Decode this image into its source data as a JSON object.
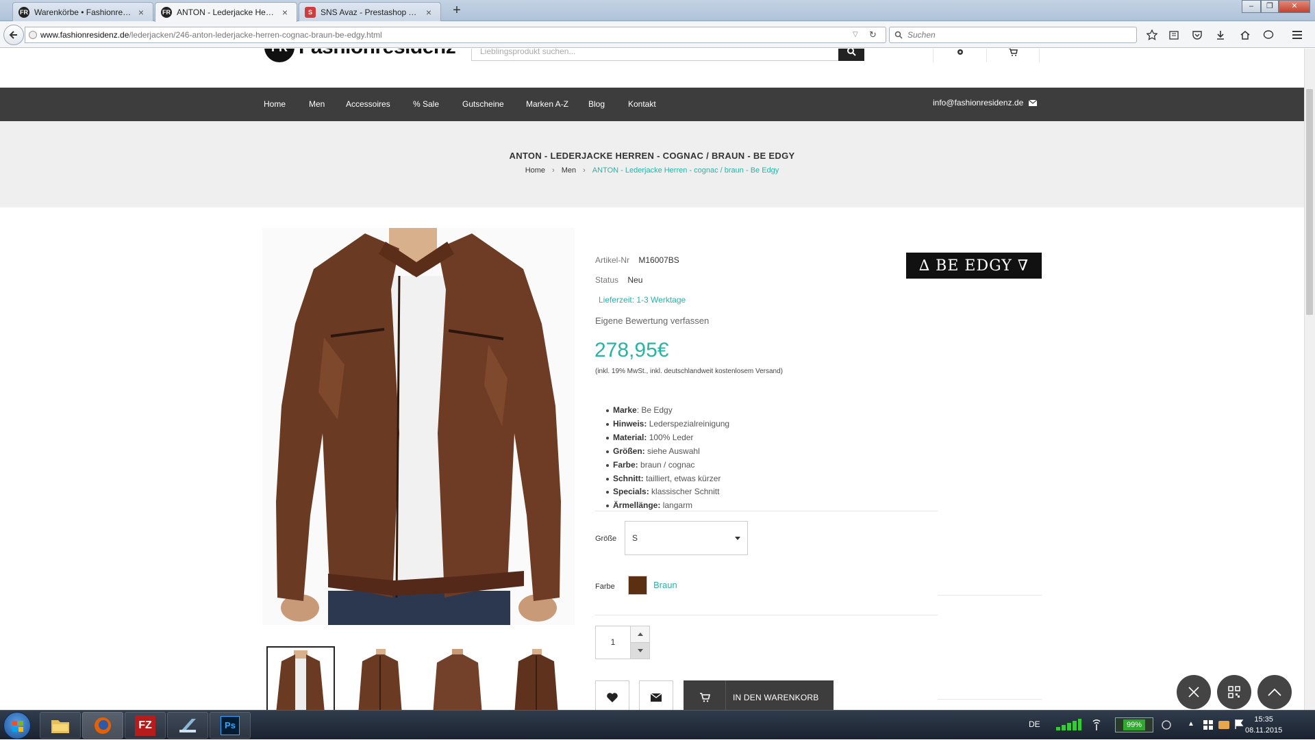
{
  "browser": {
    "tabs": [
      {
        "title": "Warenkörbe • Fashionresid...",
        "active": false
      },
      {
        "title": "ANTON - Lederjacke Herre...",
        "active": true
      },
      {
        "title": "SNS Avaz - Prestashop The...",
        "active": false
      }
    ],
    "url_domain": "www.fashionresidenz.de",
    "url_path": "/lederjacken/246-anton-lederjacke-herren-cognac-braun-be-edgy.html",
    "search_placeholder": "Suchen"
  },
  "site": {
    "logo_mark": "FR",
    "logo_text": "Fashionresidenz",
    "search_placeholder": "Lieblingsprodukt suchen...",
    "nav": [
      "Home",
      "Men",
      "Accessoires",
      "% Sale",
      "Gutscheine",
      "Marken A-Z",
      "Blog",
      "Kontakt"
    ],
    "email": "info@fashionresidenz.de"
  },
  "page": {
    "title": "ANTON - LEDERJACKE HERREN - COGNAC / BRAUN - BE EDGY",
    "breadcrumb": [
      "Home",
      "Men",
      "ANTON - Lederjacke Herren - cognac / braun - Be Edgy"
    ]
  },
  "product": {
    "artnr_label": "Artikel-Nr",
    "artnr": "M16007BS",
    "status_label": "Status",
    "status": "Neu",
    "delivery": "Lieferzeit: 1-3 Werktage",
    "review_link": "Eigene Bewertung verfassen",
    "price": "278,95€",
    "vat_note": "(inkl. 19% MwSt., inkl. deutschlandweit kostenlosem Versand)",
    "brand_logo": "∆ BE EDGY ∇",
    "features": [
      {
        "key": "Marke",
        "sep": ": ",
        "value": "Be Edgy"
      },
      {
        "key": "Hinweis:",
        "sep": " ",
        "value": "Lederspezialreinigung"
      },
      {
        "key": "Material:",
        "sep": " ",
        "value": "100% Leder"
      },
      {
        "key": "Größen:",
        "sep": " ",
        "value": "siehe Auswahl"
      },
      {
        "key": "Farbe:",
        "sep": " ",
        "value": "braun / cognac"
      },
      {
        "key": "Schnitt:",
        "sep": " ",
        "value": "tailliert, etwas kürzer"
      },
      {
        "key": "Specials:",
        "sep": " ",
        "value": "klassischer Schnitt"
      },
      {
        "key": "Ärmellänge:",
        "sep": " ",
        "value": "langarm"
      }
    ],
    "size_label": "Größe",
    "size_value": "S",
    "color_label": "Farbe",
    "color_name": "Braun",
    "color_hex": "#5b2f12",
    "quantity": "1",
    "add_to_cart": "IN DEN WARENKORB"
  },
  "taskbar": {
    "lang": "DE",
    "battery": "99%",
    "time": "15:35",
    "date": "08.11.2015"
  },
  "colors": {
    "accent": "#28b4a4",
    "nav_bg": "#3d3d3d",
    "leather": "#6b3a22"
  }
}
